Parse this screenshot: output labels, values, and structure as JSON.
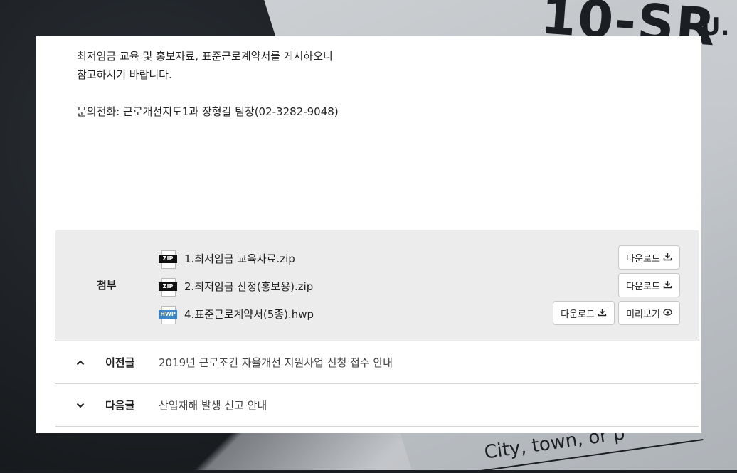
{
  "content": {
    "line1": "최저임금 교육 및 홍보자료, 표준근로계약서를 게시하오니",
    "line2": "참고하시기 바랍니다.",
    "line3": "문의전화: 근로개선지도1과 장형길 팀장(02-3282-9048)"
  },
  "attachments": {
    "label": "첨부",
    "files": [
      {
        "type": "ZIP",
        "name": "1.최저임금 교육자료.zip",
        "download_label": "다운로드"
      },
      {
        "type": "ZIP",
        "name": "2.최저임금 산정(홍보용).zip",
        "download_label": "다운로드"
      },
      {
        "type": "HWP",
        "name": "4.표준근로계약서(5종).hwp",
        "download_label": "다운로드",
        "preview_label": "미리보기"
      }
    ]
  },
  "navigation": {
    "prev": {
      "label": "이전글",
      "title": "2019년 근로조건 자율개선 지원사업 신청 접수 안내",
      "icon": "chevron-up-icon"
    },
    "next": {
      "label": "다음글",
      "title": "산업재해 발생 신고 안내",
      "icon": "chevron-down-icon"
    }
  },
  "background": {
    "text_large": "10-SR",
    "text_small": "U.",
    "text_bottom": "City, town, or p"
  }
}
